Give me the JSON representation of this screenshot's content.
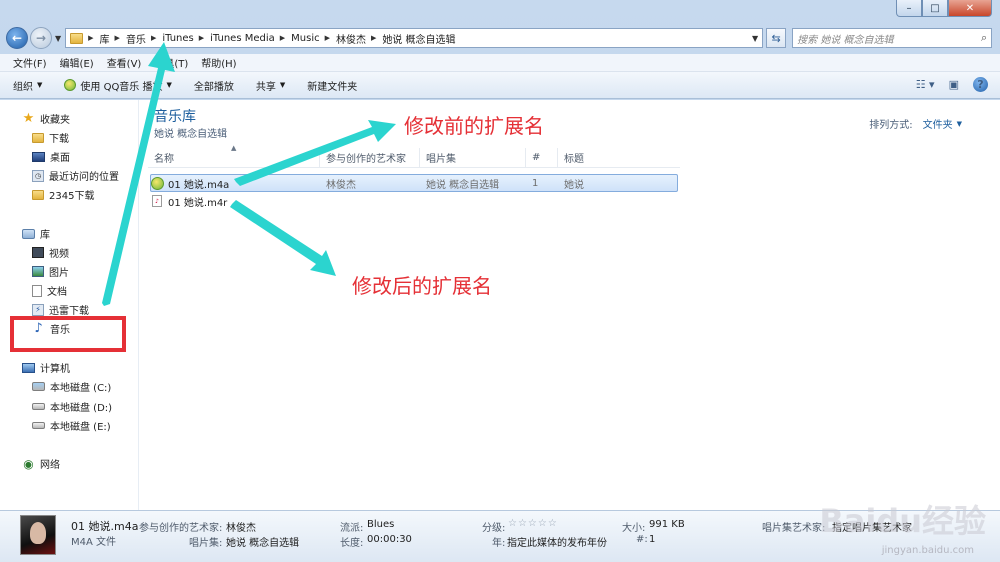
{
  "window": {
    "controls": {
      "min": "–",
      "max": "□",
      "close": "✕"
    }
  },
  "address": {
    "crumbs": [
      "库",
      "音乐",
      "iTunes",
      "iTunes Media",
      "Music",
      "林俊杰",
      "她说 概念自选辑"
    ],
    "search_placeholder": "搜索 她说 概念自选辑"
  },
  "menu": [
    "文件(F)",
    "编辑(E)",
    "查看(V)",
    "工具(T)",
    "帮助(H)"
  ],
  "toolbar": {
    "organize": "组织",
    "play_qq": "使用 QQ音乐 播放",
    "play_all": "全部播放",
    "share": "共享",
    "new_folder": "新建文件夹"
  },
  "sidebar": {
    "favorites": "收藏夹",
    "fav_items": [
      "下载",
      "桌面",
      "最近访问的位置",
      "2345下载"
    ],
    "libraries": "库",
    "lib_items": [
      "视频",
      "图片",
      "文档",
      "迅雷下载",
      "音乐"
    ],
    "computer": "计算机",
    "drives": [
      "本地磁盘 (C:)",
      "本地磁盘 (D:)",
      "本地磁盘 (E:)"
    ],
    "network": "网络"
  },
  "library": {
    "title": "音乐库",
    "subtitle": "她说 概念自选辑",
    "arrange_label": "排列方式:",
    "arrange_value": "文件夹"
  },
  "columns": [
    "名称",
    "参与创作的艺术家",
    "唱片集",
    "#",
    "标题"
  ],
  "files": [
    {
      "name": "01 她说.m4a",
      "artist": "林俊杰",
      "album": "她说 概念自选辑",
      "track": "1",
      "title": "她说"
    },
    {
      "name": "01 她说.m4r",
      "artist": "",
      "album": "",
      "track": "",
      "title": ""
    }
  ],
  "annotations": {
    "before": "修改前的扩展名",
    "after": "修改后的扩展名"
  },
  "details": {
    "filename": "01 她说.m4a",
    "filetype": "M4A 文件",
    "artist_label": "参与创作的艺术家:",
    "artist": "林俊杰",
    "album_label": "唱片集:",
    "album": "她说 概念自选辑",
    "genre_label": "流派:",
    "genre": "Blues",
    "length_label": "长度:",
    "length": "00:00:30",
    "rating_label": "分级:",
    "rating_stars": "☆☆☆☆☆",
    "year_label": "年:",
    "year": "指定此媒体的发布年份",
    "size_label": "大小:",
    "size": "991 KB",
    "track_label": "#:",
    "track": "1",
    "album_artist_label": "唱片集艺术家:",
    "album_artist": "指定唱片集艺术家"
  },
  "watermark": {
    "main": "Baidu经验",
    "sub": "jingyan.baidu.com"
  },
  "colors": {
    "annotation": "#e53036",
    "arrow": "#2bd4cf",
    "accent": "#1e5f9e"
  }
}
